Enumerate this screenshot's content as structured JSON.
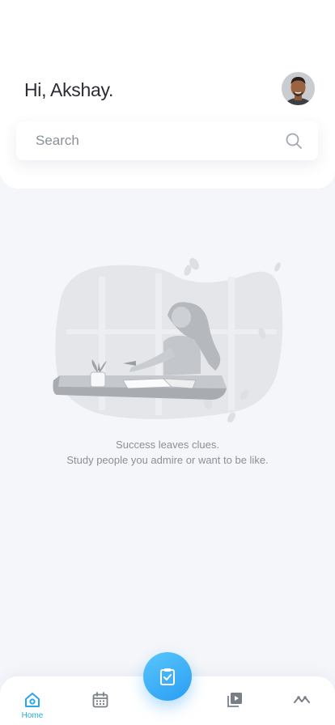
{
  "header": {
    "greeting": "Hi, Akshay."
  },
  "search": {
    "placeholder": "Search"
  },
  "empty_state": {
    "line1": "Success leaves clues.",
    "line2": "Study people you admire or want to be like."
  },
  "tabbar": {
    "home_label": "Home",
    "active_color": "#27a9e9",
    "inactive_color": "#7a7f87"
  },
  "icons": [
    "home-icon",
    "calendar-icon",
    "clipboard-check-icon",
    "video-library-icon",
    "activity-icon",
    "search-icon"
  ]
}
